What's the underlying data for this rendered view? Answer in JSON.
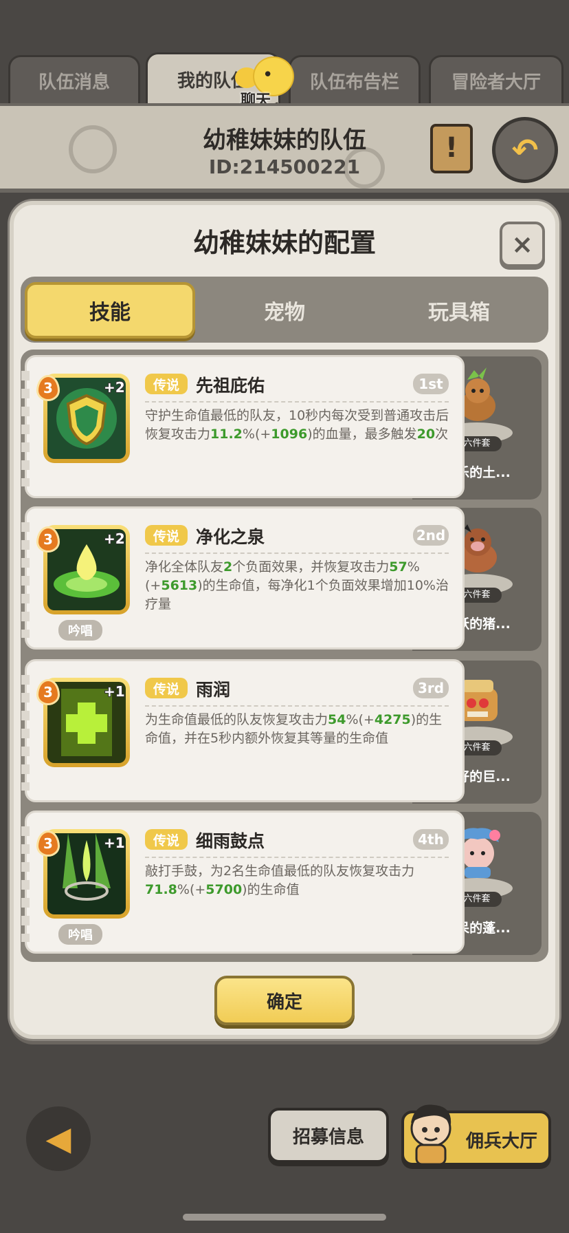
{
  "tabs": [
    "队伍消息",
    "我的队伍",
    "队伍布告栏",
    "冒险者大厅"
  ],
  "chat_label": "聊天",
  "team": {
    "name": "幼稚妹妹的队伍",
    "id": "ID:214500221"
  },
  "dialog": {
    "title": "幼稚妹妹的配置",
    "close": "×",
    "segments": [
      "技能",
      "宠物",
      "玩具箱"
    ],
    "confirm": "确定"
  },
  "skills": [
    {
      "level": "3",
      "plus": "+2",
      "tag": "传说",
      "name": "先祖庇佑",
      "rank": "1st",
      "desc": [
        {
          "t": "守护生命值最低的队友，10秒内每次受到普通攻击后恢复攻击力"
        },
        {
          "t": "11.2",
          "g": true
        },
        {
          "t": "%(+"
        },
        {
          "t": "1096",
          "g": true
        },
        {
          "t": ")的血量，最多触发"
        },
        {
          "t": "20",
          "g": true
        },
        {
          "t": "次"
        }
      ],
      "pet": "快乐的土...",
      "set": "六件套"
    },
    {
      "level": "3",
      "plus": "+2",
      "tag": "传说",
      "name": "净化之泉",
      "rank": "2nd",
      "chant": "吟唱",
      "desc": [
        {
          "t": "净化全体队友"
        },
        {
          "t": "2",
          "g": true
        },
        {
          "t": "个负面效果，并恢复攻击力"
        },
        {
          "t": "57",
          "g": true
        },
        {
          "t": "%(+"
        },
        {
          "t": "5613",
          "g": true
        },
        {
          "t": ")的生命值，每净化1个负面效果增加10%治疗量"
        }
      ],
      "pet": "活跃的猪...",
      "set": "六件套"
    },
    {
      "level": "3",
      "plus": "+1",
      "tag": "传说",
      "name": "雨润",
      "rank": "3rd",
      "desc": [
        {
          "t": "为生命值最低的队友恢复攻击力"
        },
        {
          "t": "54",
          "g": true
        },
        {
          "t": "%(+"
        },
        {
          "t": "4275",
          "g": true
        },
        {
          "t": ")的生命值，并在5秒内额外恢复其等量的生命值"
        }
      ],
      "pet": "友好的巨...",
      "set": "六件套"
    },
    {
      "level": "3",
      "plus": "+1",
      "tag": "传说",
      "name": "细雨鼓点",
      "rank": "4th",
      "chant": "吟唱",
      "desc": [
        {
          "t": "敲打手鼓，为2名生命值最低的队友恢复攻击力"
        },
        {
          "t": "71.8",
          "g": true
        },
        {
          "t": "%(+"
        },
        {
          "t": "5700",
          "g": true
        },
        {
          "t": ")的生命值"
        }
      ],
      "pet": "发呆的蓬...",
      "set": "六件套"
    }
  ],
  "bottom": {
    "recruit": "招募信息",
    "hall": "佣兵大厅"
  },
  "colors": {
    "accent_yellow": "#f4d86d",
    "green_value": "#3d9a2c",
    "legend_tag": "#f0c84a"
  }
}
